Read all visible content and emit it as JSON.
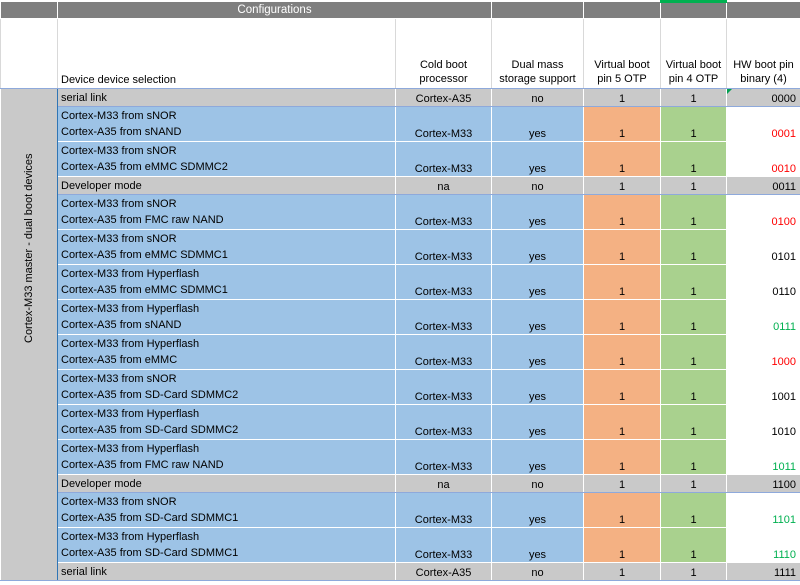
{
  "config_title": "Configurations",
  "headers": {
    "device": "Device device selection",
    "cold_boot": "Cold boot processor",
    "dual_mass": "Dual mass storage support",
    "vbp5": "Virtual boot pin 5 OTP",
    "vbp4": "Virtual boot pin 4 OTP",
    "hw_binary": "HW boot pin binary (4)"
  },
  "side_label": "Cortex-M33 master - dual boot devices",
  "rows": [
    {
      "type": "gray",
      "line1": "serial link",
      "line2": "",
      "cold": "Cortex-A35",
      "dual": "no",
      "v5": "1",
      "v4": "1",
      "bin": "0000",
      "bin_color": "black",
      "tri": true
    },
    {
      "type": "blue",
      "line1": "Cortex-M33 from sNOR",
      "line2": "Cortex-A35 from sNAND",
      "cold": "Cortex-M33",
      "dual": "yes",
      "v5": "1",
      "v4": "1",
      "bin": "0001",
      "bin_color": "red",
      "tri": false
    },
    {
      "type": "blue",
      "line1": "Cortex-M33 from sNOR",
      "line2": "Cortex-A35 from eMMC SDMMC2",
      "cold": "Cortex-M33",
      "dual": "yes",
      "v5": "1",
      "v4": "1",
      "bin": "0010",
      "bin_color": "red",
      "tri": false
    },
    {
      "type": "gray",
      "line1": "Developer mode",
      "line2": "",
      "cold": "na",
      "dual": "no",
      "v5": "1",
      "v4": "1",
      "bin": "0011",
      "bin_color": "black",
      "tri": false
    },
    {
      "type": "blue",
      "line1": "Cortex-M33 from sNOR",
      "line2": "Cortex-A35 from FMC raw NAND",
      "cold": "Cortex-M33",
      "dual": "yes",
      "v5": "1",
      "v4": "1",
      "bin": "0100",
      "bin_color": "red",
      "tri": false
    },
    {
      "type": "blue",
      "line1": "Cortex-M33 from sNOR",
      "line2": "Cortex-A35 from eMMC SDMMC1",
      "cold": "Cortex-M33",
      "dual": "yes",
      "v5": "1",
      "v4": "1",
      "bin": "0101",
      "bin_color": "black",
      "tri": false
    },
    {
      "type": "blue",
      "line1": "Cortex-M33 from Hyperflash",
      "line2": "Cortex-A35 from eMMC SDMMC1",
      "cold": "Cortex-M33",
      "dual": "yes",
      "v5": "1",
      "v4": "1",
      "bin": "0110",
      "bin_color": "black",
      "tri": false
    },
    {
      "type": "blue",
      "line1": "Cortex-M33 from Hyperflash",
      "line2": "Cortex-A35 from sNAND",
      "cold": "Cortex-M33",
      "dual": "yes",
      "v5": "1",
      "v4": "1",
      "bin": "0111",
      "bin_color": "green",
      "tri": false
    },
    {
      "type": "blue",
      "line1": "Cortex-M33 from Hyperflash",
      "line2": "Cortex-A35 from eMMC",
      "cold": "Cortex-M33",
      "dual": "yes",
      "v5": "1",
      "v4": "1",
      "bin": "1000",
      "bin_color": "red",
      "tri": false
    },
    {
      "type": "blue",
      "line1": "Cortex-M33 from sNOR",
      "line2": "Cortex-A35 from SD-Card SDMMC2",
      "cold": "Cortex-M33",
      "dual": "yes",
      "v5": "1",
      "v4": "1",
      "bin": "1001",
      "bin_color": "black",
      "tri": false
    },
    {
      "type": "blue",
      "line1": "Cortex-M33 from Hyperflash",
      "line2": "Cortex-A35 from SD-Card SDMMC2",
      "cold": "Cortex-M33",
      "dual": "yes",
      "v5": "1",
      "v4": "1",
      "bin": "1010",
      "bin_color": "black",
      "tri": false
    },
    {
      "type": "blue",
      "line1": "Cortex-M33 from Hyperflash",
      "line2": "Cortex-A35 from FMC raw NAND",
      "cold": "Cortex-M33",
      "dual": "yes",
      "v5": "1",
      "v4": "1",
      "bin": "1011",
      "bin_color": "green",
      "tri": false
    },
    {
      "type": "gray",
      "line1": "Developer mode",
      "line2": "",
      "cold": "na",
      "dual": "no",
      "v5": "1",
      "v4": "1",
      "bin": "1100",
      "bin_color": "black",
      "tri": false
    },
    {
      "type": "blue",
      "line1": "Cortex-M33 from sNOR",
      "line2": "Cortex-A35 from SD-Card SDMMC1",
      "cold": "Cortex-M33",
      "dual": "yes",
      "v5": "1",
      "v4": "1",
      "bin": "1101",
      "bin_color": "green",
      "tri": false
    },
    {
      "type": "blue",
      "line1": "Cortex-M33 from Hyperflash",
      "line2": "Cortex-A35 from SD-Card SDMMC1",
      "cold": "Cortex-M33",
      "dual": "yes",
      "v5": "1",
      "v4": "1",
      "bin": "1110",
      "bin_color": "green",
      "tri": false
    },
    {
      "type": "gray",
      "line1": "serial link",
      "line2": "",
      "cold": "Cortex-A35",
      "dual": "no",
      "v5": "1",
      "v4": "1",
      "bin": "1111",
      "bin_color": "black",
      "tri": false
    }
  ]
}
